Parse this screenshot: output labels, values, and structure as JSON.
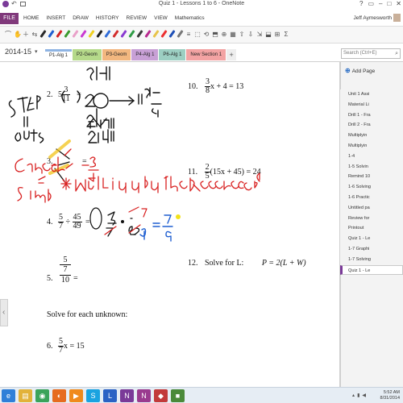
{
  "window": {
    "title": "Quiz 1 - Lessons 1 to 6 - OneNote",
    "controls": [
      "?",
      "▭",
      "–",
      "□",
      "✕"
    ]
  },
  "ribbon": {
    "file_label": "FILE",
    "tabs": [
      "HOME",
      "INSERT",
      "DRAW",
      "HISTORY",
      "REVIEW",
      "VIEW",
      "Mathematics"
    ],
    "user_name": "Jeff Aymesworth"
  },
  "toolbar": {
    "pen_colors": [
      "#2a2a2a",
      "#1f5fd1",
      "#d42323",
      "#3a9b2e",
      "#e9a0c8",
      "#c93ad1",
      "#f0d020",
      "#1d1d1d",
      "#2f6cd8",
      "#d22c2c",
      "#8a3bd1",
      "#2f9c45",
      "#3a3a3a",
      "#b82a8f",
      "#e7c34a",
      "#ec2f2f",
      "#1e4fb6",
      "#777777"
    ],
    "symbols": [
      "⌒",
      "✋",
      "＋",
      "⇆",
      "≡",
      "⬚",
      "⟲",
      "⬒",
      "⊕",
      "▦",
      "⇧",
      "⇩",
      "⇲",
      "⬓",
      "⊞",
      "Σ"
    ]
  },
  "notebook": {
    "name": "2014-15",
    "section_tabs": [
      {
        "label": "P1-Alg 1",
        "color": "#8eb4e3",
        "active": true
      },
      {
        "label": "P2-Geom",
        "color": "#b5d98a",
        "active": false
      },
      {
        "label": "P3-Geom",
        "color": "#f2b77f",
        "active": false
      },
      {
        "label": "P4-Alg 1",
        "color": "#c8a0d6",
        "active": false
      },
      {
        "label": "P6-Alg 1",
        "color": "#9ccfc2",
        "active": false
      },
      {
        "label": "New Section 1",
        "color": "#f3a3a3",
        "active": false
      }
    ],
    "add_tab": "+",
    "search_placeholder": "Search (Ctrl+E)"
  },
  "problems": {
    "p2_num": "2.",
    "p2_whole": "5",
    "p2_num_frac": "3",
    "p2_den": "11",
    "p2_eq": "=",
    "p3_num": "3.",
    "p3_eq": "=",
    "p4_num": "4.",
    "p4_a_n": "5",
    "p4_a_d": "7",
    "p4_op": "÷",
    "p4_b_n": "45",
    "p4_b_d": "49",
    "p4_eq": "=",
    "p5_num": "5.",
    "p5_top": "5",
    "p5_mid": "7",
    "p5_bot": "10",
    "p5_eq": "=",
    "section_heading": "Solve for each unknown:",
    "p6_num": "6.",
    "p6_n": "5",
    "p6_d": "7",
    "p6_rest": "x = 15",
    "p10_num": "10.",
    "p10_n": "3",
    "p10_d": "8",
    "p10_rest": "x + 4 = 13",
    "p11_num": "11.",
    "p11_n": "2",
    "p11_d": "5",
    "p11_rest": "(15x + 45) = 24",
    "p12_num": "12.",
    "p12_text": "Solve for L:",
    "p12_formula": "P = 2(L + W)"
  },
  "ink_text": {
    "step_label": "STEP",
    "step_11": "11",
    "step_outof": "out 8",
    "top_frac": "8·1/11",
    "result_a": "20+1 4/11",
    "result_b": "21 4/11",
    "right_frac": "11/15  -11  4",
    "arrow_result": "11 1/15",
    "p3_ans": "= 3/4",
    "p3_n": "3",
    "p3_d": "4",
    "cancel_note": "Cancel & Simp.",
    "multiply_note": "*Multiply by the Reciprocal",
    "p4_work": "5/7 · 49/45",
    "p4_ans": "= 7/9",
    "p4_ans_n": "7",
    "p4_ans_d": "9"
  },
  "page_panel": {
    "add_page": "Add Page",
    "pages": [
      {
        "label": "Unit 1 Assi",
        "active": false
      },
      {
        "label": "Material Li",
        "active": false
      },
      {
        "label": "Drill 1 - Fra",
        "active": false
      },
      {
        "label": "Drill 2 - Fra",
        "active": false
      },
      {
        "label": "Multiplyin",
        "active": false
      },
      {
        "label": "Multiplyin",
        "active": false
      },
      {
        "label": "1-4",
        "active": false
      },
      {
        "label": "1-5 Solvin",
        "active": false
      },
      {
        "label": "Remind 10",
        "active": false
      },
      {
        "label": "1-6 Solving",
        "active": false
      },
      {
        "label": "1-6 Practic",
        "active": false
      },
      {
        "label": "Untitled pa",
        "active": false
      },
      {
        "label": "Review for",
        "active": false
      },
      {
        "label": "Printout",
        "active": false
      },
      {
        "label": "Quiz 1 - Le",
        "active": false
      },
      {
        "label": "1-7 Graphi",
        "active": false
      },
      {
        "label": "1-7 Solving",
        "active": false
      },
      {
        "label": "Quiz 1 - Le",
        "active": true
      }
    ]
  },
  "taskbar": {
    "apps": [
      {
        "icon": "ie-icon",
        "glyph": "e",
        "color": "#2f7fd8"
      },
      {
        "icon": "explorer-icon",
        "glyph": "▤",
        "color": "#e2b23a"
      },
      {
        "icon": "chrome-icon",
        "glyph": "◉",
        "color": "#3aa35a"
      },
      {
        "icon": "firefox-icon",
        "glyph": "◐",
        "color": "#e66b1f"
      },
      {
        "icon": "mediaplayer-icon",
        "glyph": "▶",
        "color": "#f08a1c"
      },
      {
        "icon": "skype-icon",
        "glyph": "S",
        "color": "#1aa3e0"
      },
      {
        "icon": "lync-icon",
        "glyph": "L",
        "color": "#2b62c4"
      },
      {
        "icon": "onenote-icon",
        "glyph": "N",
        "color": "#7a3a98"
      },
      {
        "icon": "onenote2-icon",
        "glyph": "N",
        "color": "#9a3b8f"
      },
      {
        "icon": "app-icon",
        "glyph": "◆",
        "color": "#c23a3a"
      },
      {
        "icon": "app2-icon",
        "glyph": "■",
        "color": "#4b8a3a"
      }
    ],
    "time": "5:52 AM",
    "date": "8/31/2014"
  }
}
